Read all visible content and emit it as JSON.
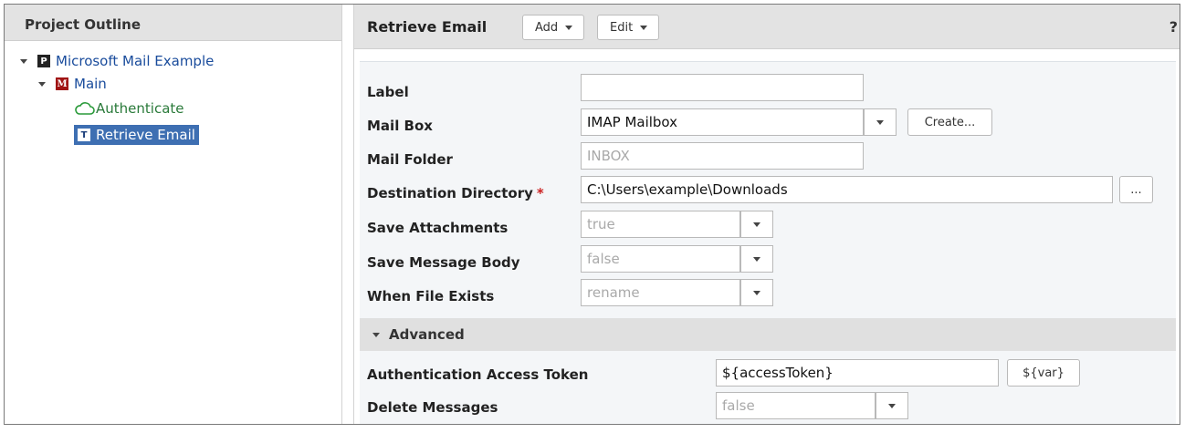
{
  "outline": {
    "title": "Project Outline",
    "nodes": [
      {
        "label": "Microsoft Mail Example",
        "icon": "project-icon",
        "icon_glyph": "P"
      },
      {
        "label": "Main",
        "icon": "module-icon",
        "icon_glyph": "M"
      },
      {
        "label": "Authenticate",
        "icon": "cloud-icon"
      },
      {
        "label": "Retrieve Email",
        "icon": "task-icon",
        "icon_glyph": "T",
        "selected": true
      }
    ]
  },
  "editor": {
    "title": "Retrieve Email",
    "add_label": "Add",
    "edit_label": "Edit",
    "help_label": "?",
    "fields": {
      "label": {
        "label": "Label",
        "value": ""
      },
      "mail_box": {
        "label": "Mail Box",
        "value": "IMAP Mailbox",
        "create_label": "Create..."
      },
      "mail_folder": {
        "label": "Mail Folder",
        "placeholder": "INBOX"
      },
      "destination_directory": {
        "label": "Destination Directory",
        "required_mark": "*",
        "value": "C:\\Users\\example\\Downloads",
        "browse_label": "..."
      },
      "save_attachments": {
        "label": "Save Attachments",
        "placeholder": "true"
      },
      "save_message_body": {
        "label": "Save Message Body",
        "placeholder": "false"
      },
      "when_file_exists": {
        "label": "When File Exists",
        "placeholder": "rename"
      }
    },
    "advanced": {
      "title": "Advanced",
      "auth_token": {
        "label": "Authentication Access Token",
        "value": "${accessToken}",
        "var_label": "${var}"
      },
      "delete_messages": {
        "label": "Delete Messages",
        "placeholder": "false"
      }
    }
  },
  "colors": {
    "selection": "#3e6fb2",
    "header_bg": "#e3e3e3",
    "required": "#cc2222",
    "link": "#1a4c9c",
    "auth_green": "#2a7a3a"
  }
}
